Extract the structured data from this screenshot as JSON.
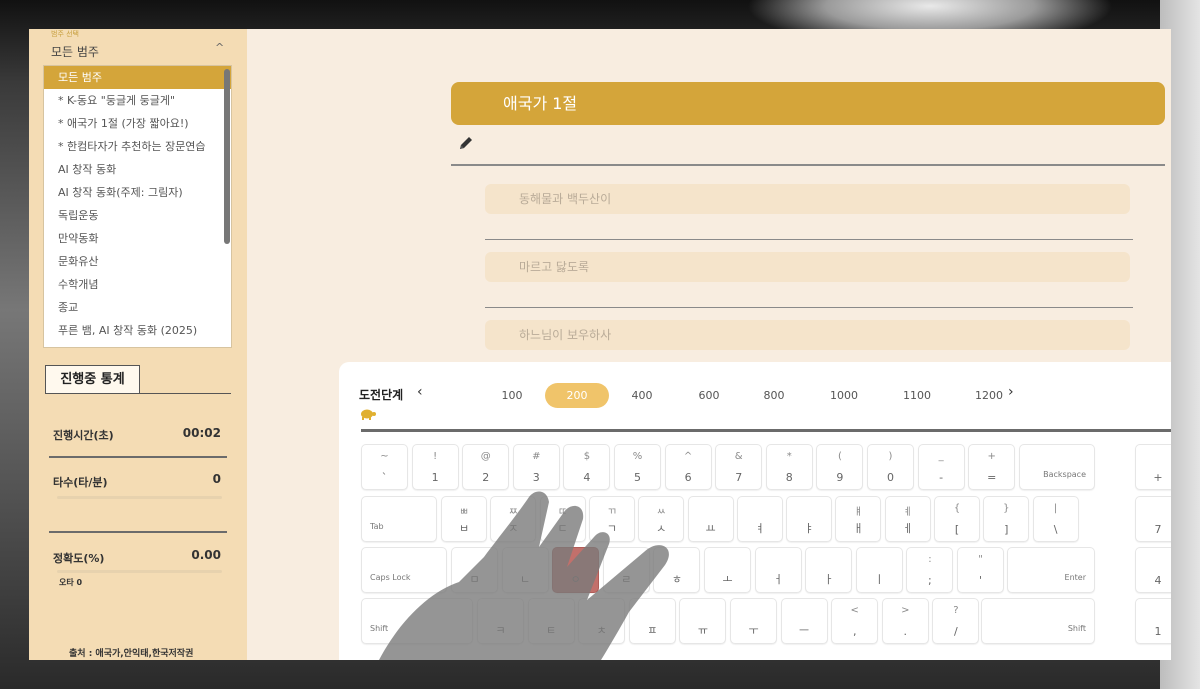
{
  "sidebar": {
    "kicker": "범주 선택",
    "heading": "모든 범주",
    "categories": [
      "모든 범주",
      "* K-동요 \"둥글게 둥글게\"",
      "* 애국가 1절 (가장 짧아요!)",
      "* 한컴타자가 추천하는 장문연습",
      "AI 창작 동화",
      "AI 창작 동화(주제: 그림자)",
      "독립운동",
      "만약동화",
      "문화유산",
      "수학개념",
      "종교",
      "푸른 뱀, AI 창작 동화 (2025)"
    ],
    "active_index": 0
  },
  "stats": {
    "tab_label": "진행중 통계",
    "time_label": "진행시간(초)",
    "time_value": "00:02",
    "speed_label": "타수(타/분)",
    "speed_value": "0",
    "accuracy_label": "정확도(%)",
    "accuracy_value": "0.00",
    "errors_label": "오타 0"
  },
  "source": "출처 : 애국가,안익태,한국저작권",
  "main": {
    "title": "애국가 1절",
    "lines": [
      "동해물과 백두산이",
      "마르고 닳도록",
      "하느님이 보우하사"
    ]
  },
  "challenge": {
    "label": "도전단계",
    "levels": [
      "100",
      "200",
      "400",
      "600",
      "800",
      "1000",
      "1100",
      "1200"
    ],
    "active_level": "200",
    "prev_icon": "chevron-left-icon",
    "next_icon": "chevron-right-icon"
  },
  "keyboard": {
    "highlight_color": "#c2706b",
    "row1": [
      {
        "t": "~",
        "b": "`"
      },
      {
        "t": "!",
        "b": "1"
      },
      {
        "t": "@",
        "b": "2"
      },
      {
        "t": "#",
        "b": "3"
      },
      {
        "t": "$",
        "b": "4"
      },
      {
        "t": "%",
        "b": "5"
      },
      {
        "t": "^",
        "b": "6"
      },
      {
        "t": "&",
        "b": "7"
      },
      {
        "t": "*",
        "b": "8"
      },
      {
        "t": "(",
        "b": "9"
      },
      {
        "t": ")",
        "b": "0"
      },
      {
        "t": "_",
        "b": "-"
      },
      {
        "t": "+",
        "b": "="
      }
    ],
    "backspace": "Backspace",
    "tab": "Tab",
    "row2": [
      {
        "t": "ㅃ",
        "b": "ㅂ"
      },
      {
        "t": "ㅉ",
        "b": "ㅈ"
      },
      {
        "t": "ㄸ",
        "b": "ㄷ"
      },
      {
        "t": "ㄲ",
        "b": "ㄱ"
      },
      {
        "t": "ㅆ",
        "b": "ㅅ"
      },
      {
        "t": "",
        "b": "ㅛ"
      },
      {
        "t": "",
        "b": "ㅕ"
      },
      {
        "t": "",
        "b": "ㅑ"
      },
      {
        "t": "ㅒ",
        "b": "ㅐ"
      },
      {
        "t": "ㅖ",
        "b": "ㅔ"
      },
      {
        "t": "{",
        "b": "["
      },
      {
        "t": "}",
        "b": "]"
      },
      {
        "t": "|",
        "b": "\\"
      }
    ],
    "caps": "Caps Lock",
    "row3": [
      {
        "t": "",
        "b": "ㅁ"
      },
      {
        "t": "",
        "b": "ㄴ"
      },
      {
        "t": "",
        "b": "ㅇ"
      },
      {
        "t": "",
        "b": "ㄹ"
      },
      {
        "t": "",
        "b": "ㅎ"
      },
      {
        "t": "",
        "b": "ㅗ"
      },
      {
        "t": "",
        "b": "ㅓ"
      },
      {
        "t": "",
        "b": "ㅏ"
      },
      {
        "t": "",
        "b": "ㅣ"
      },
      {
        "t": ":",
        "b": ";"
      },
      {
        "t": "\"",
        "b": "'"
      }
    ],
    "enter": "Enter",
    "shift_left": "Shift",
    "row4": [
      {
        "t": "",
        "b": "ㅋ"
      },
      {
        "t": "",
        "b": "ㅌ"
      },
      {
        "t": "",
        "b": "ㅊ"
      },
      {
        "t": "",
        "b": "ㅍ"
      },
      {
        "t": "",
        "b": "ㅠ"
      },
      {
        "t": "",
        "b": "ㅜ"
      },
      {
        "t": "",
        "b": "ㅡ"
      },
      {
        "t": "<",
        "b": ","
      },
      {
        "t": ">",
        "b": "."
      },
      {
        "t": "?",
        "b": "/"
      }
    ],
    "shift_right": "Shift",
    "numpad": [
      "+",
      "7",
      "4",
      "1"
    ],
    "highlighted_key": "ㅇ"
  }
}
